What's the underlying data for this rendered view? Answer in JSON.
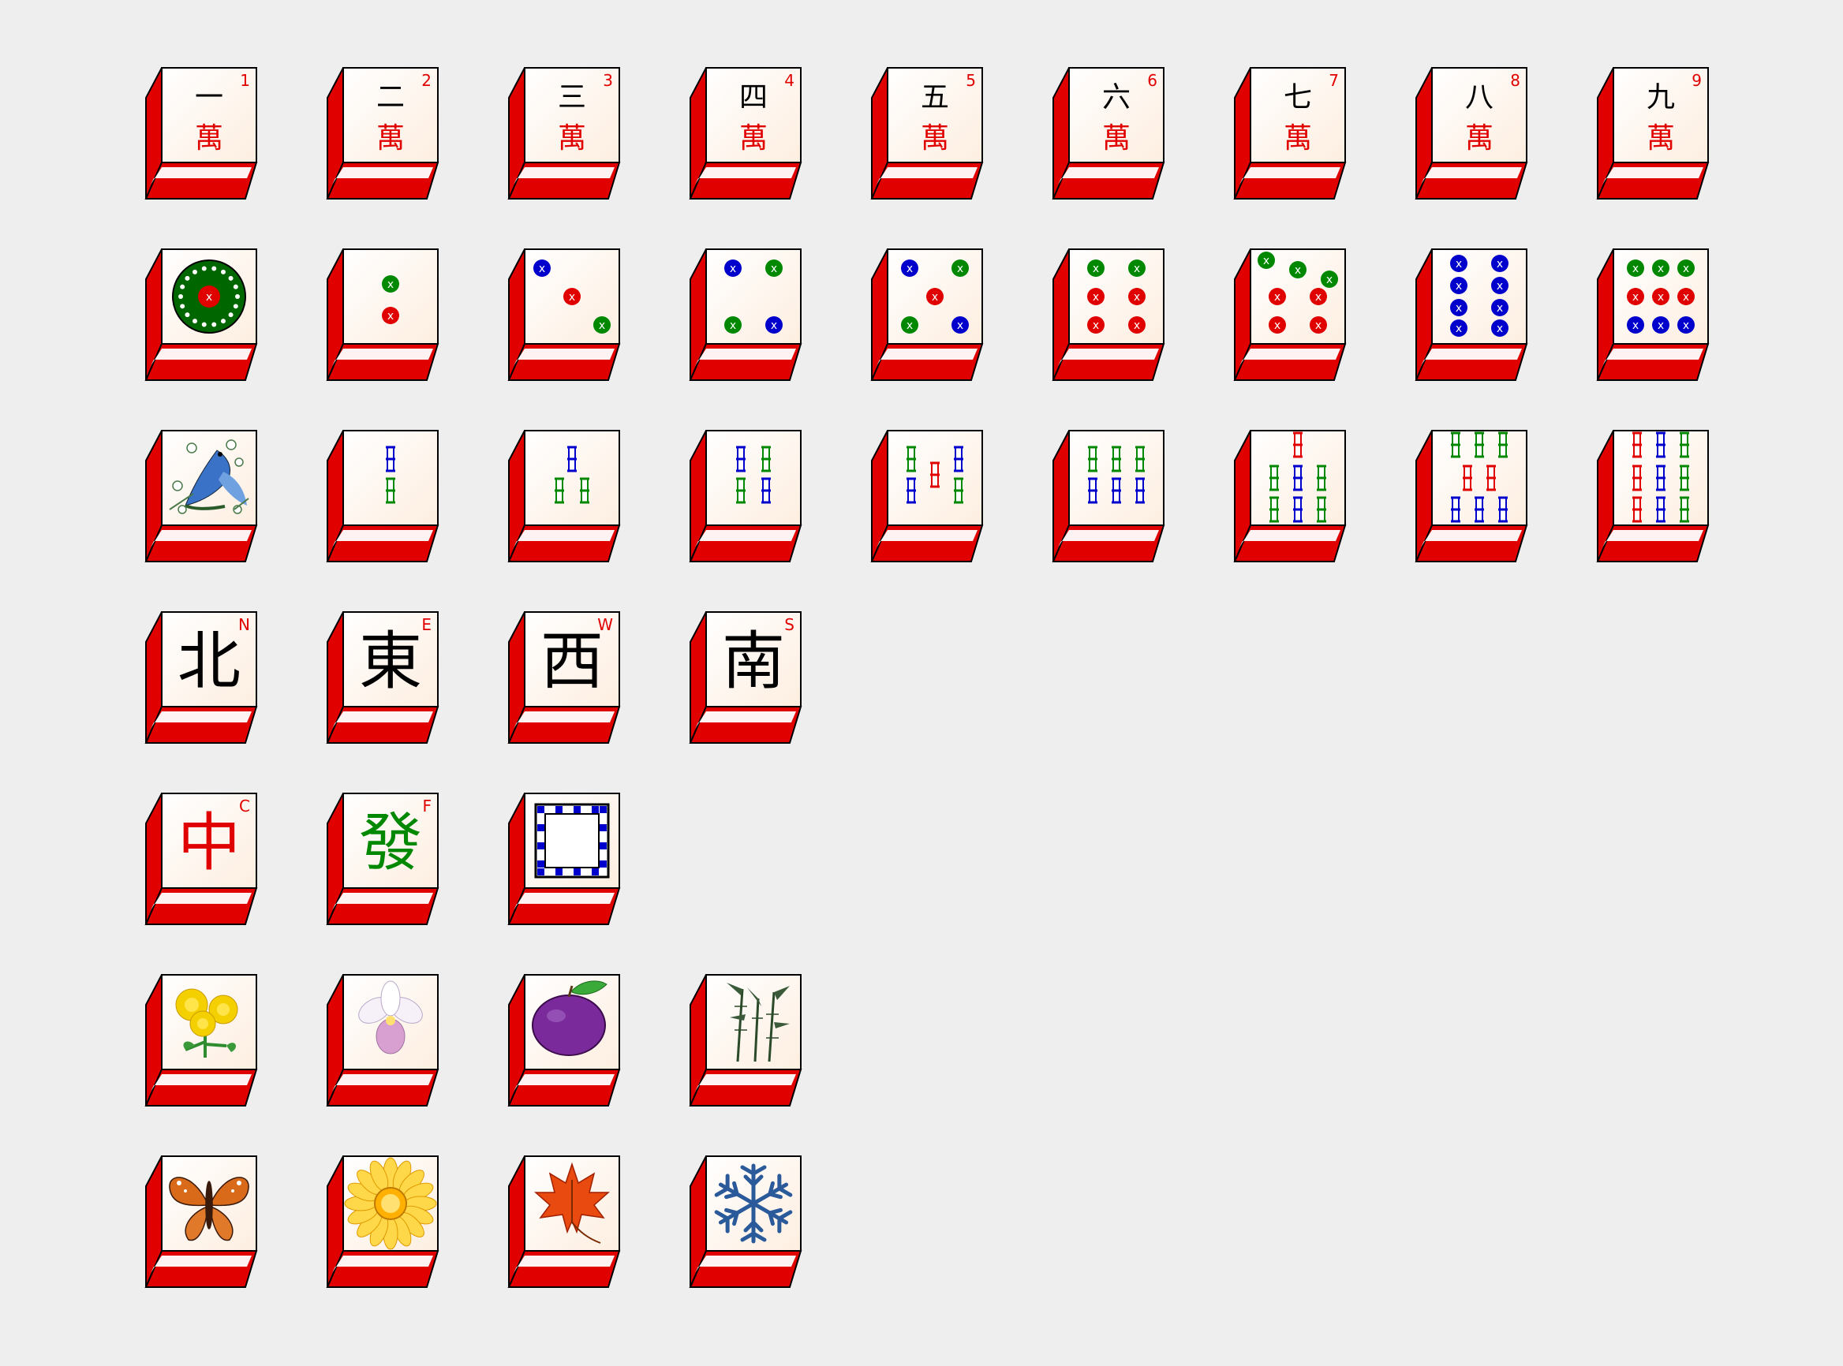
{
  "colors": {
    "background": "#eeeeee",
    "tile_face": "#fff8f0",
    "tile_side": "#e00000",
    "index_text": "#e00000",
    "dot_green": "#008800",
    "dot_red": "#e00000",
    "dot_blue": "#0000cc"
  },
  "rows": [
    {
      "name": "characters",
      "tiles": [
        {
          "kind": "character",
          "numeral": "一",
          "suit_char": "萬",
          "index": "1"
        },
        {
          "kind": "character",
          "numeral": "二",
          "suit_char": "萬",
          "index": "2"
        },
        {
          "kind": "character",
          "numeral": "三",
          "suit_char": "萬",
          "index": "3"
        },
        {
          "kind": "character",
          "numeral": "四",
          "suit_char": "萬",
          "index": "4"
        },
        {
          "kind": "character",
          "numeral": "五",
          "suit_char": "萬",
          "index": "5"
        },
        {
          "kind": "character",
          "numeral": "六",
          "suit_char": "萬",
          "index": "6"
        },
        {
          "kind": "character",
          "numeral": "七",
          "suit_char": "萬",
          "index": "7"
        },
        {
          "kind": "character",
          "numeral": "八",
          "suit_char": "萬",
          "index": "8"
        },
        {
          "kind": "character",
          "numeral": "九",
          "suit_char": "萬",
          "index": "9"
        }
      ]
    },
    {
      "name": "circles",
      "tiles": [
        {
          "kind": "circle",
          "count": 1
        },
        {
          "kind": "circle",
          "count": 2
        },
        {
          "kind": "circle",
          "count": 3
        },
        {
          "kind": "circle",
          "count": 4
        },
        {
          "kind": "circle",
          "count": 5
        },
        {
          "kind": "circle",
          "count": 6
        },
        {
          "kind": "circle",
          "count": 7
        },
        {
          "kind": "circle",
          "count": 8
        },
        {
          "kind": "circle",
          "count": 9
        }
      ]
    },
    {
      "name": "bamboos",
      "tiles": [
        {
          "kind": "bamboo",
          "count": 1,
          "icon": "bird-icon"
        },
        {
          "kind": "bamboo",
          "count": 2
        },
        {
          "kind": "bamboo",
          "count": 3
        },
        {
          "kind": "bamboo",
          "count": 4
        },
        {
          "kind": "bamboo",
          "count": 5
        },
        {
          "kind": "bamboo",
          "count": 6
        },
        {
          "kind": "bamboo",
          "count": 7
        },
        {
          "kind": "bamboo",
          "count": 8
        },
        {
          "kind": "bamboo",
          "count": 9
        }
      ]
    },
    {
      "name": "winds",
      "tiles": [
        {
          "kind": "wind",
          "char": "北",
          "index": "N"
        },
        {
          "kind": "wind",
          "char": "東",
          "index": "E"
        },
        {
          "kind": "wind",
          "char": "西",
          "index": "W"
        },
        {
          "kind": "wind",
          "char": "南",
          "index": "S"
        }
      ]
    },
    {
      "name": "dragons",
      "tiles": [
        {
          "kind": "dragon",
          "char": "中",
          "index": "C",
          "color": "#e00000"
        },
        {
          "kind": "dragon",
          "char": "發",
          "index": "F",
          "color": "#008800"
        },
        {
          "kind": "dragon",
          "char": "",
          "index": "",
          "color": "#0000cc",
          "icon": "white-dragon-frame-icon"
        }
      ]
    },
    {
      "name": "flowers",
      "tiles": [
        {
          "kind": "picture",
          "icon": "chrysanthemum-icon"
        },
        {
          "kind": "picture",
          "icon": "orchid-icon"
        },
        {
          "kind": "picture",
          "icon": "plum-icon"
        },
        {
          "kind": "picture",
          "icon": "bamboo-plant-icon"
        }
      ]
    },
    {
      "name": "seasons",
      "tiles": [
        {
          "kind": "picture",
          "icon": "butterfly-icon"
        },
        {
          "kind": "picture",
          "icon": "sunflower-icon"
        },
        {
          "kind": "picture",
          "icon": "maple-leaf-icon"
        },
        {
          "kind": "picture",
          "icon": "snowflake-icon"
        }
      ]
    }
  ]
}
